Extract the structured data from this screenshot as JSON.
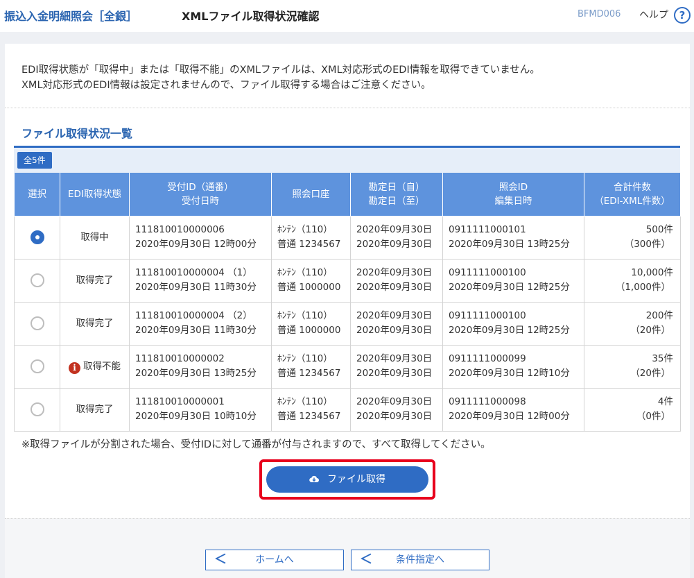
{
  "header": {
    "screen_title": "振込入金明細照会［全銀］",
    "page_title": "XMLファイル取得状況確認",
    "screen_id": "BFMD006",
    "help_label": "ヘルプ",
    "help_icon": "?"
  },
  "notice": {
    "line1": "EDI取得状態が「取得中」または「取得不能」のXMLファイルは、XML対応形式のEDI情報を取得できていません。",
    "line2": "XML対応形式のEDI情報は設定されませんので、ファイル取得する場合はご注意ください。"
  },
  "section": {
    "title": "ファイル取得状況一覧",
    "count_label": "全5件"
  },
  "table": {
    "headers": {
      "select": "選択",
      "edi_status": "EDI取得状態",
      "receipt_id": "受付ID（通番）",
      "receipt_datetime": "受付日時",
      "account": "照会口座",
      "date_from": "勘定日（自）",
      "date_to": "勘定日（至）",
      "inquiry_id": "照会ID",
      "edit_datetime": "編集日時",
      "total": "合計件数",
      "total_sub": "（EDI-XML件数）"
    },
    "rows": [
      {
        "selected": true,
        "status": "取得中",
        "status_icon": "",
        "receipt_id": "111810010000006",
        "receipt_datetime": "2020年09月30日 12時00分",
        "branch": "ﾎﾝﾃﾝ（110）",
        "account": "普通 1234567",
        "date_from": "2020年09月30日",
        "date_to": "2020年09月30日",
        "inquiry_id": "0911111000101",
        "edit_datetime": "2020年09月30日 13時25分",
        "total": "500件",
        "total_sub": "（300件）"
      },
      {
        "selected": false,
        "status": "取得完了",
        "status_icon": "",
        "receipt_id": "111810010000004 （1）",
        "receipt_datetime": "2020年09月30日 11時30分",
        "branch": "ﾎﾝﾃﾝ（110）",
        "account": "普通 1000000",
        "date_from": "2020年09月30日",
        "date_to": "2020年09月30日",
        "inquiry_id": "0911111000100",
        "edit_datetime": "2020年09月30日 12時25分",
        "total": "10,000件",
        "total_sub": "（1,000件）"
      },
      {
        "selected": false,
        "status": "取得完了",
        "status_icon": "",
        "receipt_id": "111810010000004 （2）",
        "receipt_datetime": "2020年09月30日 11時30分",
        "branch": "ﾎﾝﾃﾝ（110）",
        "account": "普通 1000000",
        "date_from": "2020年09月30日",
        "date_to": "2020年09月30日",
        "inquiry_id": "0911111000100",
        "edit_datetime": "2020年09月30日 12時25分",
        "total": "200件",
        "total_sub": "（20件）"
      },
      {
        "selected": false,
        "status": "取得不能",
        "status_icon": "i",
        "receipt_id": "111810010000002",
        "receipt_datetime": "2020年09月30日 13時25分",
        "branch": "ﾎﾝﾃﾝ（110）",
        "account": "普通 1234567",
        "date_from": "2020年09月30日",
        "date_to": "2020年09月30日",
        "inquiry_id": "0911111000099",
        "edit_datetime": "2020年09月30日 12時10分",
        "total": "35件",
        "total_sub": "（20件）"
      },
      {
        "selected": false,
        "status": "取得完了",
        "status_icon": "",
        "receipt_id": "111810010000001",
        "receipt_datetime": "2020年09月30日 10時10分",
        "branch": "ﾎﾝﾃﾝ（110）",
        "account": "普通 1234567",
        "date_from": "2020年09月30日",
        "date_to": "2020年09月30日",
        "inquiry_id": "0911111000098",
        "edit_datetime": "2020年09月30日 12時00分",
        "total": "4件",
        "total_sub": "（0件）"
      }
    ]
  },
  "footnote": "※取得ファイルが分割された場合、受付IDに対して通番が付与されますので、すべて取得してください。",
  "actions": {
    "fetch_label": "ファイル取得",
    "fetch_icon": "cloud-download-icon",
    "home_label": "ホームへ",
    "back_label": "条件指定へ",
    "chevron": "＜"
  },
  "colors": {
    "accent": "#2f6cc4",
    "header_row": "#5e93dd",
    "highlight": "#e8001d",
    "error_icon": "#c23220"
  }
}
